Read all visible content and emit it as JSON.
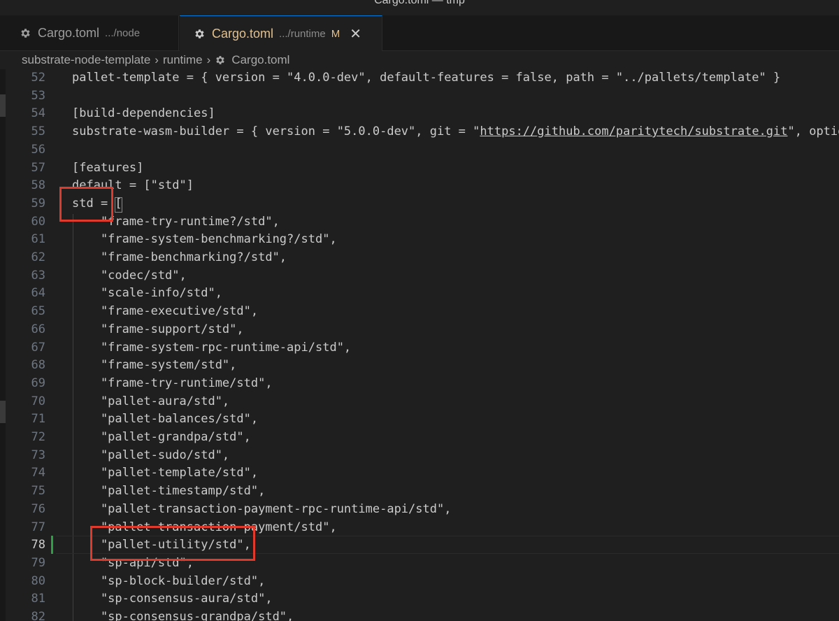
{
  "window": {
    "title": "Cargo.toml — tmp"
  },
  "tabs": [
    {
      "name": "Cargo.toml",
      "path": ".../node",
      "status": ""
    },
    {
      "name": "Cargo.toml",
      "path": ".../runtime",
      "status": "M",
      "close": "✕"
    }
  ],
  "breadcrumb": {
    "items": [
      "substrate-node-template",
      "runtime",
      "Cargo.toml"
    ],
    "separator": "›"
  },
  "editor": {
    "current_line": 78,
    "lines": [
      {
        "num": "52",
        "text": "pallet-template = { version = \"4.0.0-dev\", default-features = false, path = \"../pallets/template\" }"
      },
      {
        "num": "53",
        "text": ""
      },
      {
        "num": "54",
        "text": "[build-dependencies]"
      },
      {
        "num": "55",
        "text_before": "substrate-wasm-builder = { version = \"5.0.0-dev\", git = \"",
        "link": "https://github.com/paritytech/substrate.git",
        "text_after": "\", optional = true }"
      },
      {
        "num": "56",
        "text": ""
      },
      {
        "num": "57",
        "text": "[features]"
      },
      {
        "num": "58",
        "text": "default = [\"std\"]"
      },
      {
        "num": "59",
        "text": "std = ["
      },
      {
        "num": "60",
        "text": "    \"frame-try-runtime?/std\","
      },
      {
        "num": "61",
        "text": "    \"frame-system-benchmarking?/std\","
      },
      {
        "num": "62",
        "text": "    \"frame-benchmarking?/std\","
      },
      {
        "num": "63",
        "text": "    \"codec/std\","
      },
      {
        "num": "64",
        "text": "    \"scale-info/std\","
      },
      {
        "num": "65",
        "text": "    \"frame-executive/std\","
      },
      {
        "num": "66",
        "text": "    \"frame-support/std\","
      },
      {
        "num": "67",
        "text": "    \"frame-system-rpc-runtime-api/std\","
      },
      {
        "num": "68",
        "text": "    \"frame-system/std\","
      },
      {
        "num": "69",
        "text": "    \"frame-try-runtime/std\","
      },
      {
        "num": "70",
        "text": "    \"pallet-aura/std\","
      },
      {
        "num": "71",
        "text": "    \"pallet-balances/std\","
      },
      {
        "num": "72",
        "text": "    \"pallet-grandpa/std\","
      },
      {
        "num": "73",
        "text": "    \"pallet-sudo/std\","
      },
      {
        "num": "74",
        "text": "    \"pallet-template/std\","
      },
      {
        "num": "75",
        "text": "    \"pallet-timestamp/std\","
      },
      {
        "num": "76",
        "text": "    \"pallet-transaction-payment-rpc-runtime-api/std\","
      },
      {
        "num": "77",
        "text": "    \"pallet-transaction-payment/std\","
      },
      {
        "num": "78",
        "text": "    \"pallet-utility/std\","
      },
      {
        "num": "79",
        "text": "    \"sp-api/std\","
      },
      {
        "num": "80",
        "text": "    \"sp-block-builder/std\","
      },
      {
        "num": "81",
        "text": "    \"sp-consensus-aura/std\","
      },
      {
        "num": "82",
        "text": "    \"sp-consensus-grandpa/std\","
      }
    ]
  },
  "colors": {
    "highlight": "#e03a2c",
    "modified_tab": "#e2c08d",
    "git_added": "#2ea043"
  }
}
